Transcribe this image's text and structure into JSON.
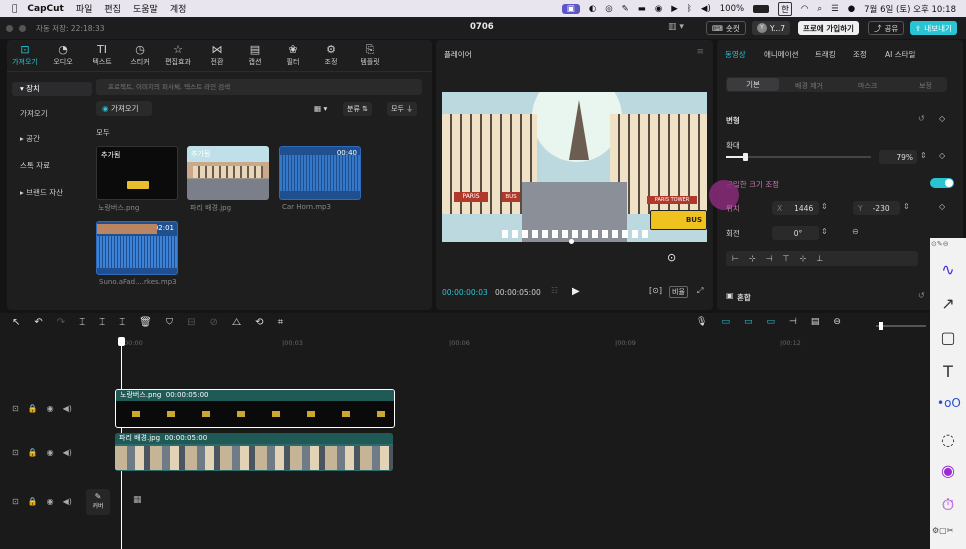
{
  "macbar": {
    "app": "CapCut",
    "menus": [
      "파일",
      "편집",
      "도움말",
      "계정"
    ],
    "battery": "100%",
    "status_lang": "한",
    "datetime": "7월 6일 (토) 오후 10:18"
  },
  "titlebar": {
    "autosave": "자동 저장: 22:18:33",
    "project": "0706",
    "shortcut_label": "숏컷",
    "user_label": "Y...7",
    "pro_label": "프로에 가입하기",
    "share_label": "공유",
    "export_label": "내보내기"
  },
  "tools": [
    {
      "label": "가져오기",
      "icon": "import-icon"
    },
    {
      "label": "오디오",
      "icon": "audio-icon"
    },
    {
      "label": "텍스트",
      "icon": "text-icon"
    },
    {
      "label": "스티커",
      "icon": "sticker-icon"
    },
    {
      "label": "편집효과",
      "icon": "effects-icon"
    },
    {
      "label": "전환",
      "icon": "transition-icon"
    },
    {
      "label": "캡션",
      "icon": "caption-icon"
    },
    {
      "label": "필터",
      "icon": "filter-icon"
    },
    {
      "label": "조정",
      "icon": "adjust-icon"
    },
    {
      "label": "템플릿",
      "icon": "template-icon"
    }
  ],
  "leftnav": [
    "▾ 장치",
    "가져오기",
    "▸ 공간",
    "스톡 자료",
    "▸ 브랜드 자산"
  ],
  "media": {
    "search_placeholder": "프로젝트, 이미지의 피사체, 텍스트 라인 검색",
    "import_label": "가져오기",
    "sort_label": "분류",
    "all_label": "모두",
    "filter_label": "모두",
    "section": "모두",
    "items": [
      {
        "name": "노랑버스.png",
        "badge": "추가됨",
        "duration": ""
      },
      {
        "name": "파리 배경.jpg",
        "badge": "추가됨",
        "duration": ""
      },
      {
        "name": "Car Horn.mp3",
        "badge": "",
        "duration": "00:40"
      },
      {
        "name": "Suno.aFad....rkes.mp3",
        "badge": "",
        "duration": "02:01"
      }
    ]
  },
  "player": {
    "title": "플레이어",
    "current": "00:00:00:03",
    "total": "00:00:05:00",
    "ratio_label": "비율",
    "sign_paris": "PARIS",
    "sign_bus": "BUS",
    "sign_tower": "PARIS TOWER"
  },
  "props": {
    "tabs": [
      "동영상",
      "애니메이션",
      "트래킹",
      "조정",
      "AI 스타일"
    ],
    "subtabs": [
      "기본",
      "배경 제거",
      "마스크",
      "보정"
    ],
    "transform": "변형",
    "scale_label": "확대",
    "scale_value": "79%",
    "uniform_label": "균일한 크기 조정",
    "position_label": "위치",
    "x_label": "X",
    "x_value": "1446",
    "y_label": "Y",
    "y_value": "-230",
    "rotate_label": "회전",
    "rotate_value": "0°",
    "blend_label": "혼합",
    "scale_fraction": 0.13
  },
  "timeline": {
    "ruler": [
      "00:00",
      "|00:03",
      "|00:06",
      "|00:09",
      "|00:12"
    ],
    "clip1_name": "노랑버스.png",
    "clip1_time": "00:00:05:00",
    "clip2_name": "파리 배경.jpg",
    "clip2_time": "00:00:05:00",
    "cover_label": "커버"
  },
  "colors": {
    "accent": "#29c4d4",
    "clip1": "#1f5a57",
    "clip2": "#2a6b6b",
    "audio": "#2d5e9e"
  }
}
